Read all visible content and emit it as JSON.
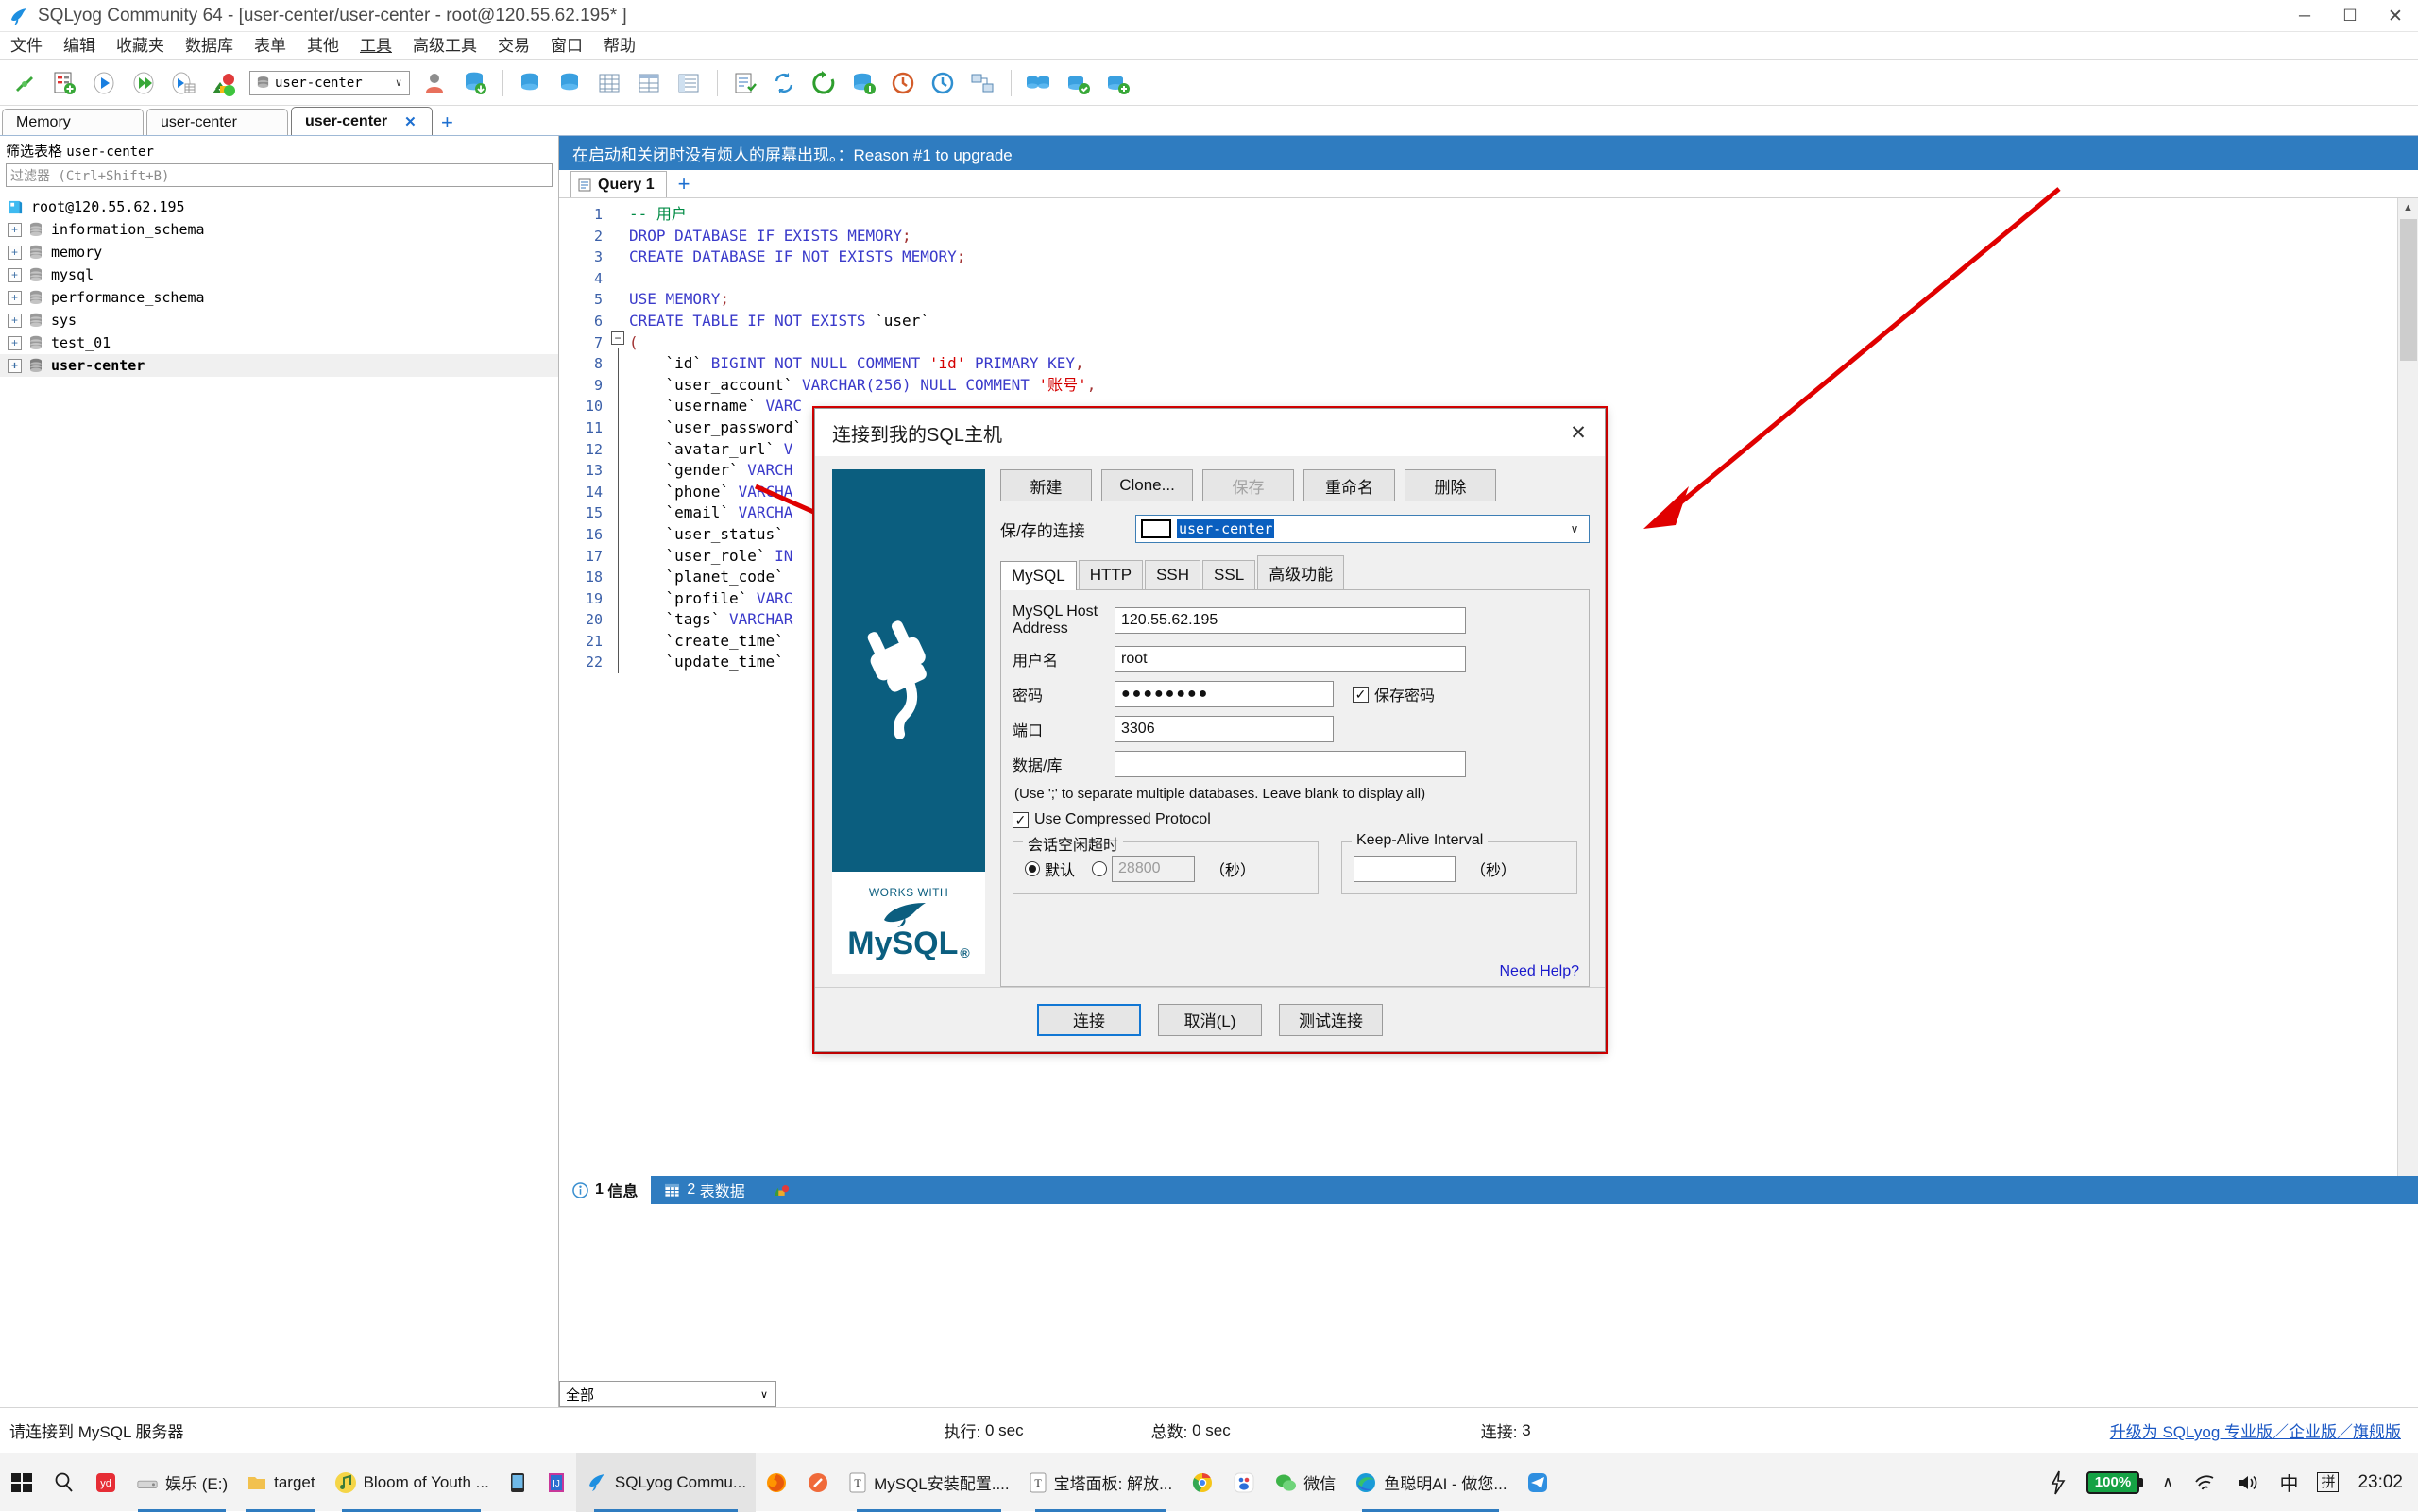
{
  "window": {
    "title": "SQLyog Community 64 - [user-center/user-center - root@120.55.62.195* ]",
    "minimize": "─",
    "maximize": "☐",
    "close": "✕"
  },
  "menubar": {
    "items": [
      {
        "label": "文件"
      },
      {
        "label": "编辑"
      },
      {
        "label": "收藏夹"
      },
      {
        "label": "数据库"
      },
      {
        "label": "表单"
      },
      {
        "label": "其他"
      },
      {
        "label": "工具"
      },
      {
        "label": "高级工具"
      },
      {
        "label": "交易"
      },
      {
        "label": "窗口"
      },
      {
        "label": "帮助"
      }
    ]
  },
  "toolbar": {
    "db_selector_value": "user-center",
    "db_selector_arrow": "∨"
  },
  "connection_tabs": {
    "tabs": [
      {
        "label": "Memory",
        "active": false
      },
      {
        "label": "user-center",
        "active": false
      },
      {
        "label": "user-center",
        "active": true,
        "close": "✕"
      }
    ],
    "add_label": "+"
  },
  "sidebar": {
    "filter_label_cn": "筛选表格",
    "filter_label_db": "user-center",
    "filter_placeholder": "过滤器 (Ctrl+Shift+B)",
    "tree": {
      "root": "root@120.55.62.195",
      "databases": [
        {
          "name": "information_schema",
          "selected": false
        },
        {
          "name": "memory",
          "selected": false
        },
        {
          "name": "mysql",
          "selected": false
        },
        {
          "name": "performance_schema",
          "selected": false
        },
        {
          "name": "sys",
          "selected": false
        },
        {
          "name": "test_01",
          "selected": false
        },
        {
          "name": "user-center",
          "selected": true
        }
      ],
      "expander": "+"
    }
  },
  "banner": {
    "text": "在启动和关闭时没有烦人的屏幕出现。：Reason #1 to upgrade"
  },
  "query_tab": {
    "label": "Query 1",
    "add_label": "+"
  },
  "editor": {
    "lines": [
      {
        "n": 1,
        "tokens": [
          {
            "t": "-- 用户",
            "c": "cmt"
          }
        ]
      },
      {
        "n": 2,
        "tokens": [
          {
            "t": "DROP DATABASE IF EXISTS MEMORY",
            "c": "kw"
          },
          {
            "t": ";",
            "c": "punc"
          }
        ]
      },
      {
        "n": 3,
        "tokens": [
          {
            "t": "CREATE DATABASE IF NOT EXISTS MEMORY",
            "c": "kw"
          },
          {
            "t": ";",
            "c": "punc"
          }
        ]
      },
      {
        "n": 4,
        "tokens": []
      },
      {
        "n": 5,
        "tokens": [
          {
            "t": "USE MEMORY",
            "c": "kw"
          },
          {
            "t": ";",
            "c": "punc"
          }
        ]
      },
      {
        "n": 6,
        "tokens": [
          {
            "t": "CREATE TABLE IF NOT EXISTS ",
            "c": "kw"
          },
          {
            "t": "`user`",
            "c": "ident"
          }
        ]
      },
      {
        "n": 7,
        "tokens": [
          {
            "t": "(",
            "c": "punc"
          }
        ]
      },
      {
        "n": 8,
        "tokens": [
          {
            "t": "    `id` ",
            "c": "ident"
          },
          {
            "t": "BIGINT NOT NULL COMMENT ",
            "c": "kw"
          },
          {
            "t": "'id'",
            "c": "str"
          },
          {
            "t": " PRIMARY KEY",
            "c": "kw"
          },
          {
            "t": ",",
            "c": "punc"
          }
        ]
      },
      {
        "n": 9,
        "tokens": [
          {
            "t": "    `user_account` ",
            "c": "ident"
          },
          {
            "t": "VARCHAR(256) NULL COMMENT ",
            "c": "kw"
          },
          {
            "t": "'账号'",
            "c": "str"
          },
          {
            "t": ",",
            "c": "punc"
          }
        ]
      },
      {
        "n": 10,
        "tokens": [
          {
            "t": "    `username` ",
            "c": "ident"
          },
          {
            "t": "VARC",
            "c": "kw"
          }
        ]
      },
      {
        "n": 11,
        "tokens": [
          {
            "t": "    `user_password`",
            "c": "ident"
          }
        ]
      },
      {
        "n": 12,
        "tokens": [
          {
            "t": "    `avatar_url` ",
            "c": "ident"
          },
          {
            "t": "V",
            "c": "kw"
          }
        ]
      },
      {
        "n": 13,
        "tokens": [
          {
            "t": "    `gender` ",
            "c": "ident"
          },
          {
            "t": "VARCH",
            "c": "kw"
          }
        ]
      },
      {
        "n": 14,
        "tokens": [
          {
            "t": "    `phone` ",
            "c": "ident"
          },
          {
            "t": "VARCHA",
            "c": "kw"
          }
        ]
      },
      {
        "n": 15,
        "tokens": [
          {
            "t": "    `email` ",
            "c": "ident"
          },
          {
            "t": "VARCHA",
            "c": "kw"
          }
        ]
      },
      {
        "n": 16,
        "tokens": [
          {
            "t": "    `user_status` ",
            "c": "ident"
          }
        ]
      },
      {
        "n": 17,
        "tokens": [
          {
            "t": "    `user_role` ",
            "c": "ident"
          },
          {
            "t": "IN",
            "c": "kw"
          }
        ]
      },
      {
        "n": 18,
        "tokens": [
          {
            "t": "    `planet_code` ",
            "c": "ident"
          }
        ]
      },
      {
        "n": 19,
        "tokens": [
          {
            "t": "    `profile` ",
            "c": "ident"
          },
          {
            "t": "VARC",
            "c": "kw"
          }
        ]
      },
      {
        "n": 20,
        "tokens": [
          {
            "t": "    `tags` ",
            "c": "ident"
          },
          {
            "t": "VARCHAR",
            "c": "kw"
          }
        ]
      },
      {
        "n": 21,
        "tokens": [
          {
            "t": "    `create_time` ",
            "c": "ident"
          }
        ]
      },
      {
        "n": 22,
        "tokens": [
          {
            "t": "    `update_time` ",
            "c": "ident"
          }
        ]
      }
    ]
  },
  "results": {
    "tabs": [
      {
        "num": "1",
        "label": "信息",
        "active": true
      },
      {
        "num": "2",
        "label": "表数据",
        "active": false
      }
    ],
    "bottom_select_value": "全部",
    "bottom_select_arrow": "∨"
  },
  "statusbar": {
    "message": "请连接到 MySQL 服务器",
    "exec_label": "执行:",
    "exec_value": "0 sec",
    "total_label": "总数:",
    "total_value": "0 sec",
    "conn_label": "连接:",
    "conn_value": "3",
    "upgrade_link": "升级为 SQLyog 专业版／企业版／旗舰版"
  },
  "dialog": {
    "title": "连接到我的SQL主机",
    "close": "✕",
    "buttons": [
      {
        "label": "新建",
        "disabled": false
      },
      {
        "label": "Clone...",
        "disabled": false
      },
      {
        "label": "保存",
        "disabled": true
      },
      {
        "label": "重命名",
        "disabled": false
      },
      {
        "label": "删除",
        "disabled": false
      }
    ],
    "saved_connection_label": "保/存的连接",
    "saved_connection_value": "user-center",
    "saved_connection_arrow": "∨",
    "tabs": [
      {
        "label": "MySQL",
        "active": true
      },
      {
        "label": "HTTP",
        "active": false
      },
      {
        "label": "SSH",
        "active": false
      },
      {
        "label": "SSL",
        "active": false
      },
      {
        "label": "高级功能",
        "active": false
      }
    ],
    "fields": {
      "host_label": "MySQL Host Address",
      "host_value": "120.55.62.195",
      "user_label": "用户名",
      "user_value": "root",
      "password_label": "密码",
      "password_value": "●●●●●●●●",
      "save_password_label": "保存密码",
      "save_password_checked": "✓",
      "port_label": "端口",
      "port_value": "3306",
      "database_label": "数据/库",
      "database_value": ""
    },
    "hint": "(Use ';' to separate multiple databases. Leave blank to display all)",
    "compressed_label": "Use Compressed Protocol",
    "compressed_checked": "✓",
    "idle_group_label": "会话空闲超时",
    "idle_default_label": "默认",
    "idle_custom_value": "28800",
    "idle_unit": "（秒）",
    "keepalive_group_label": "Keep-Alive Interval",
    "keepalive_value": "",
    "keepalive_unit": "（秒）",
    "need_help": "Need Help?",
    "footer_buttons": [
      {
        "label": "连接",
        "primary": true
      },
      {
        "label": "取消(L)",
        "primary": false
      },
      {
        "label": "测试连接",
        "primary": false
      }
    ],
    "logo_works_with": "WORKS WITH",
    "logo_my": "MySQL",
    "logo_reg": "®"
  },
  "taskbar": {
    "items": [
      {
        "label": "娱乐 (E:)",
        "icon": "drive-icon",
        "running": true
      },
      {
        "label": "target",
        "icon": "folder-icon",
        "running": true
      },
      {
        "label": "Bloom of Youth ...",
        "icon": "music-icon",
        "running": true
      },
      {
        "label": "",
        "icon": "phone-icon",
        "running": false
      },
      {
        "label": "",
        "icon": "editor-icon",
        "running": false
      },
      {
        "label": "SQLyog Commu...",
        "icon": "sqlyog-icon",
        "running": true,
        "active": true
      },
      {
        "label": "",
        "icon": "firefox-icon",
        "running": false
      },
      {
        "label": "",
        "icon": "pen-icon",
        "running": false
      },
      {
        "label": "MySQL安装配置....",
        "icon": "text-doc-icon",
        "running": true
      },
      {
        "label": "宝塔面板: 解放...",
        "icon": "text-doc-icon",
        "running": true
      },
      {
        "label": "",
        "icon": "chrome-icon",
        "running": false
      },
      {
        "label": "",
        "icon": "baidu-icon",
        "running": false
      },
      {
        "label": "微信",
        "icon": "wechat-icon",
        "running": false
      },
      {
        "label": "鱼聪明AI - 做您...",
        "icon": "edge-icon",
        "running": true
      },
      {
        "label": "",
        "icon": "telegram-icon",
        "running": false
      }
    ],
    "start_icon": "windows-start-icon",
    "search_icon": "search-icon",
    "yd_icon": "youdao-icon",
    "tray": {
      "battery_percent": "100%",
      "chevron": "∧",
      "wifi_icon": "wifi-icon",
      "volume_icon": "volume-icon",
      "ime_mode": "中",
      "ime_pinyin": "拼",
      "clock": "23:02"
    }
  }
}
